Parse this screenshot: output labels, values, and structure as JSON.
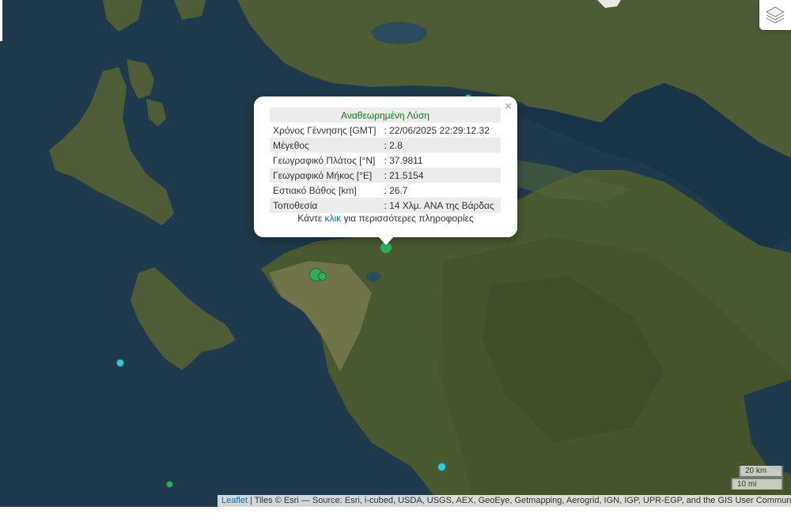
{
  "popup": {
    "header": "Αναθεωρημένη Λύση",
    "close_symbol": "×",
    "rows": [
      {
        "label": "Χρόνος Γέννησης [GMT]",
        "value": ": 22/06/2025 22:29:12.32"
      },
      {
        "label": "Μέγεθος",
        "value": ": 2.8"
      },
      {
        "label": "Γεωγραφικό Πλάτος [°N]",
        "value": ": 37.9811"
      },
      {
        "label": "Γεωγραφικό Μήκος [°E]",
        "value": ": 21.5154"
      },
      {
        "label": "Εστιακό Βάθος [km]",
        "value": ": 26.7"
      },
      {
        "label": "Τοποθεσία",
        "value": ": 14 Χλμ. ΑΝΑ της Βάρδας"
      }
    ],
    "more_prefix": "Κάντε",
    "more_link": "κλικ",
    "more_suffix": "για περισσότερες πληροφορίες"
  },
  "scale": {
    "km": "20 km",
    "mi": "10 mi"
  },
  "attribution": {
    "link": "Leaflet",
    "text": " | Tiles © Esri — Source: Esri, i-cubed, USDA, USGS, AEX, GeoEye, Getmapping, Aerogrid, IGN, IGP, UPR-EGP, and the GIS User Community"
  },
  "layers_icon": "layers-icon",
  "colors": {
    "green_marker": "#2fae5b",
    "cyan_marker": "#3cc7d6",
    "sea": "#1f3a4c",
    "land": "#4a5a32",
    "link": "#0078a8",
    "header_green": "#0a7c12"
  }
}
